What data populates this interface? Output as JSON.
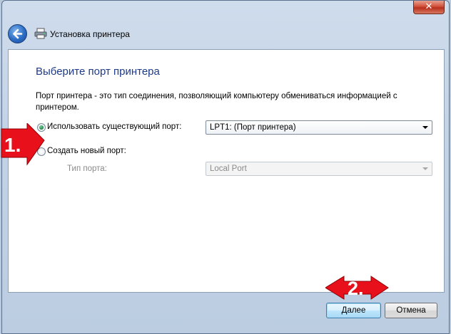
{
  "window": {
    "title": "Установка принтера",
    "close_glyph": "✕"
  },
  "icons": {
    "back": "back-arrow-icon",
    "printer": "printer-icon",
    "close": "close-icon"
  },
  "page": {
    "heading": "Выберите порт принтера",
    "description": "Порт принтера - это тип соединения, позволяющий компьютеру обмениваться информацией с принтером."
  },
  "options": {
    "existing_port": {
      "label": "Использовать существующий порт:",
      "checked": true,
      "selected_value": "LPT1: (Порт принтера)"
    },
    "new_port": {
      "label": "Создать новый порт:",
      "checked": false,
      "port_type_label": "Тип порта:",
      "selected_value": "Local Port"
    }
  },
  "footer": {
    "next_label": "Далее",
    "cancel_label": "Отмена"
  },
  "annotations": {
    "step1": "1.",
    "step2": "2."
  },
  "colors": {
    "heading": "#1e3a8a",
    "marker": "#e8101a",
    "accent": "#3c7fb1"
  }
}
